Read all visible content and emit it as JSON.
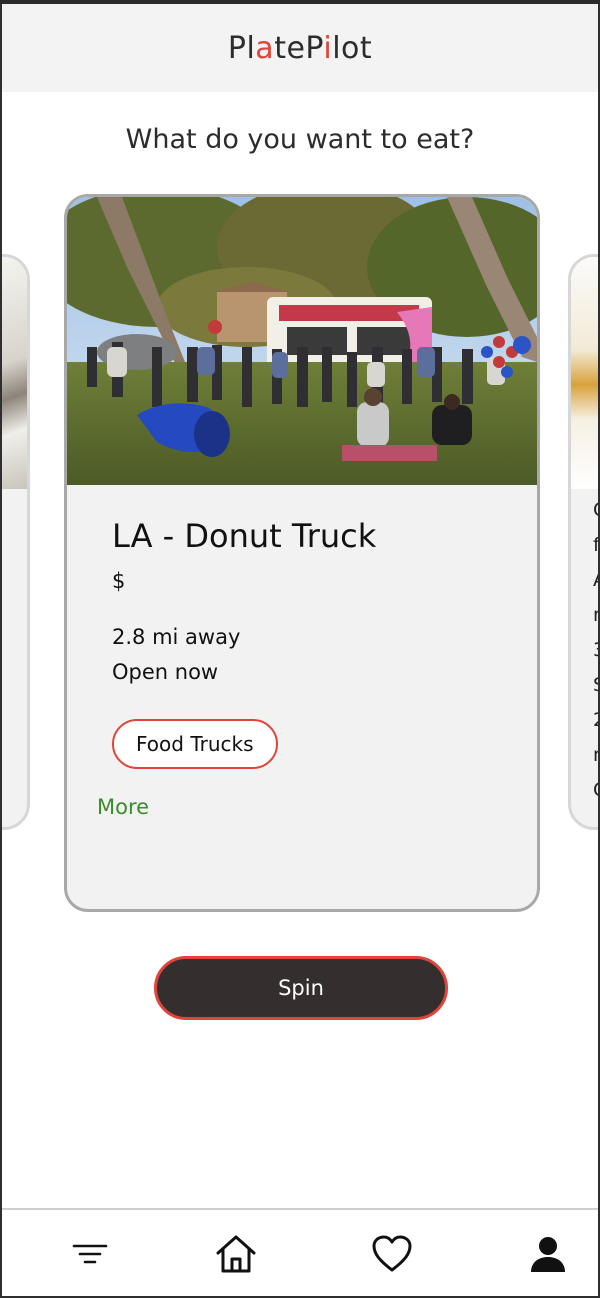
{
  "header": {
    "brand_parts": [
      "Pl",
      "a",
      "teP",
      "i",
      "lot"
    ]
  },
  "prompt": "What do you want to eat?",
  "card": {
    "title": "LA - Donut Truck",
    "price": "$",
    "distance": "2.8 mi away",
    "status": "Open now",
    "tag": "Food Trucks",
    "more_label": "More"
  },
  "right_card_peek": [
    "C",
    "f",
    "A",
    "n",
    "3",
    "S",
    "2",
    "n",
    "C"
  ],
  "spin_label": "Spin",
  "nav": [
    "filter-icon",
    "home-icon",
    "heart-icon",
    "user-icon"
  ],
  "colors": {
    "accent": "#e0443a",
    "more_link": "#3c8b2d",
    "spin_bg": "#342f2e"
  }
}
